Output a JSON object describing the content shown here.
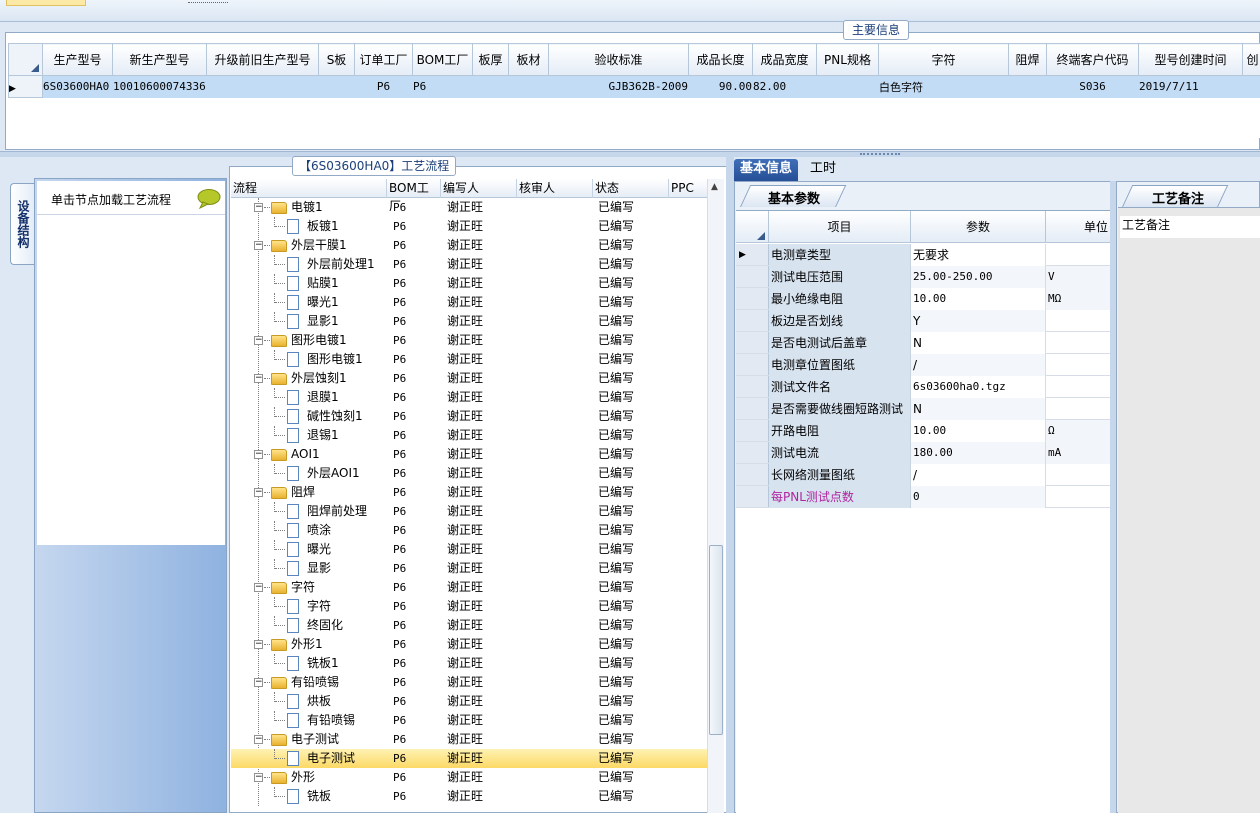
{
  "main_info": {
    "legend": "主要信息",
    "columns": [
      "生产型号",
      "新生产型号",
      "升级前旧生产型号",
      "S板",
      "订单工厂",
      "BOM工厂",
      "板厚",
      "板材",
      "验收标准",
      "成品长度",
      "成品宽度",
      "PNL规格",
      "字符",
      "阻焊",
      "终端客户代码",
      "型号创建时间",
      "创"
    ],
    "row": [
      "6S03600HA0",
      "10010600074336",
      "",
      "",
      "P6",
      "P6",
      "",
      "",
      "GJB362B-2009",
      "90.00",
      "82.00",
      "",
      "白色字符",
      "",
      "S036",
      "2019/7/11",
      ""
    ]
  },
  "left_panel": {
    "tab_label": "设备结构",
    "header_text": "单击节点加载工艺流程",
    "header_icon": "speech-bubble-icon"
  },
  "flow": {
    "legend": "【6S03600HA0】工艺流程",
    "columns": [
      "流程",
      "BOM工厂",
      "编写人",
      "核审人",
      "状态",
      "PPC"
    ],
    "rows": [
      {
        "level": 1,
        "name": "电镀1",
        "bom": "P6",
        "writer": "谢正旺",
        "reviewer": "",
        "status": "已编写"
      },
      {
        "level": 2,
        "name": "板镀1",
        "bom": "P6",
        "writer": "谢正旺",
        "reviewer": "",
        "status": "已编写"
      },
      {
        "level": 1,
        "name": "外层干膜1",
        "bom": "P6",
        "writer": "谢正旺",
        "reviewer": "",
        "status": "已编写"
      },
      {
        "level": 2,
        "name": "外层前处理1",
        "bom": "P6",
        "writer": "谢正旺",
        "reviewer": "",
        "status": "已编写"
      },
      {
        "level": 2,
        "name": "贴膜1",
        "bom": "P6",
        "writer": "谢正旺",
        "reviewer": "",
        "status": "已编写"
      },
      {
        "level": 2,
        "name": "曝光1",
        "bom": "P6",
        "writer": "谢正旺",
        "reviewer": "",
        "status": "已编写"
      },
      {
        "level": 2,
        "name": "显影1",
        "bom": "P6",
        "writer": "谢正旺",
        "reviewer": "",
        "status": "已编写"
      },
      {
        "level": 1,
        "name": "图形电镀1",
        "bom": "P6",
        "writer": "谢正旺",
        "reviewer": "",
        "status": "已编写"
      },
      {
        "level": 2,
        "name": "图形电镀1",
        "bom": "P6",
        "writer": "谢正旺",
        "reviewer": "",
        "status": "已编写"
      },
      {
        "level": 1,
        "name": "外层蚀刻1",
        "bom": "P6",
        "writer": "谢正旺",
        "reviewer": "",
        "status": "已编写"
      },
      {
        "level": 2,
        "name": "退膜1",
        "bom": "P6",
        "writer": "谢正旺",
        "reviewer": "",
        "status": "已编写"
      },
      {
        "level": 2,
        "name": "碱性蚀刻1",
        "bom": "P6",
        "writer": "谢正旺",
        "reviewer": "",
        "status": "已编写"
      },
      {
        "level": 2,
        "name": "退锡1",
        "bom": "P6",
        "writer": "谢正旺",
        "reviewer": "",
        "status": "已编写"
      },
      {
        "level": 1,
        "name": "AOI1",
        "bom": "P6",
        "writer": "谢正旺",
        "reviewer": "",
        "status": "已编写"
      },
      {
        "level": 2,
        "name": "外层AOI1",
        "bom": "P6",
        "writer": "谢正旺",
        "reviewer": "",
        "status": "已编写"
      },
      {
        "level": 1,
        "name": "阻焊",
        "bom": "P6",
        "writer": "谢正旺",
        "reviewer": "",
        "status": "已编写"
      },
      {
        "level": 2,
        "name": "阻焊前处理",
        "bom": "P6",
        "writer": "谢正旺",
        "reviewer": "",
        "status": "已编写"
      },
      {
        "level": 2,
        "name": "喷涂",
        "bom": "P6",
        "writer": "谢正旺",
        "reviewer": "",
        "status": "已编写"
      },
      {
        "level": 2,
        "name": "曝光",
        "bom": "P6",
        "writer": "谢正旺",
        "reviewer": "",
        "status": "已编写"
      },
      {
        "level": 2,
        "name": "显影",
        "bom": "P6",
        "writer": "谢正旺",
        "reviewer": "",
        "status": "已编写"
      },
      {
        "level": 1,
        "name": "字符",
        "bom": "P6",
        "writer": "谢正旺",
        "reviewer": "",
        "status": "已编写"
      },
      {
        "level": 2,
        "name": "字符",
        "bom": "P6",
        "writer": "谢正旺",
        "reviewer": "",
        "status": "已编写"
      },
      {
        "level": 2,
        "name": "终固化",
        "bom": "P6",
        "writer": "谢正旺",
        "reviewer": "",
        "status": "已编写"
      },
      {
        "level": 1,
        "name": "外形1",
        "bom": "P6",
        "writer": "谢正旺",
        "reviewer": "",
        "status": "已编写"
      },
      {
        "level": 2,
        "name": "铣板1",
        "bom": "P6",
        "writer": "谢正旺",
        "reviewer": "",
        "status": "已编写"
      },
      {
        "level": 1,
        "name": "有铅喷锡",
        "bom": "P6",
        "writer": "谢正旺",
        "reviewer": "",
        "status": "已编写"
      },
      {
        "level": 2,
        "name": "烘板",
        "bom": "P6",
        "writer": "谢正旺",
        "reviewer": "",
        "status": "已编写"
      },
      {
        "level": 2,
        "name": "有铅喷锡",
        "bom": "P6",
        "writer": "谢正旺",
        "reviewer": "",
        "status": "已编写"
      },
      {
        "level": 1,
        "name": "电子测试",
        "bom": "P6",
        "writer": "谢正旺",
        "reviewer": "",
        "status": "已编写"
      },
      {
        "level": 2,
        "name": "电子测试",
        "bom": "P6",
        "writer": "谢正旺",
        "reviewer": "",
        "status": "已编写",
        "selected": true
      },
      {
        "level": 1,
        "name": "外形",
        "bom": "P6",
        "writer": "谢正旺",
        "reviewer": "",
        "status": "已编写"
      },
      {
        "level": 2,
        "name": "铣板",
        "bom": "P6",
        "writer": "谢正旺",
        "reviewer": "",
        "status": "已编写"
      }
    ]
  },
  "right_tabs": {
    "basic": "基本信息",
    "hours": "工时"
  },
  "basic_params": {
    "subtab": "基本参数",
    "columns": [
      "项目",
      "参数",
      "单位"
    ],
    "rows": [
      {
        "item": "电测章类型",
        "value": "无要求",
        "unit": "",
        "current": true
      },
      {
        "item": "测试电压范围",
        "value": "25.00-250.00",
        "unit": "V"
      },
      {
        "item": "最小绝缘电阻",
        "value": "10.00",
        "unit": "MΩ"
      },
      {
        "item": "板边是否划线",
        "value": "Y",
        "unit": ""
      },
      {
        "item": "是否电测试后盖章",
        "value": "N",
        "unit": ""
      },
      {
        "item": "电测章位置图纸",
        "value": "/",
        "unit": ""
      },
      {
        "item": "测试文件名",
        "value": "6s03600ha0.tgz",
        "unit": ""
      },
      {
        "item": "是否需要做线圈短路测试",
        "value": "N",
        "unit": ""
      },
      {
        "item": "开路电阻",
        "value": "10.00",
        "unit": "Ω"
      },
      {
        "item": "测试电流",
        "value": "180.00",
        "unit": "mA"
      },
      {
        "item": "长网络测量图纸",
        "value": "/",
        "unit": ""
      },
      {
        "item": "每PNL测试点数",
        "value": "0",
        "unit": "",
        "highlight": true
      }
    ]
  },
  "notes": {
    "subtab": "工艺备注",
    "label": "工艺备注"
  },
  "colors": {
    "selection_row": "#c2dcf6",
    "tree_selected": "#fbd966",
    "tab_active": "#2f5ea8",
    "highlight_text": "#b0249e"
  }
}
